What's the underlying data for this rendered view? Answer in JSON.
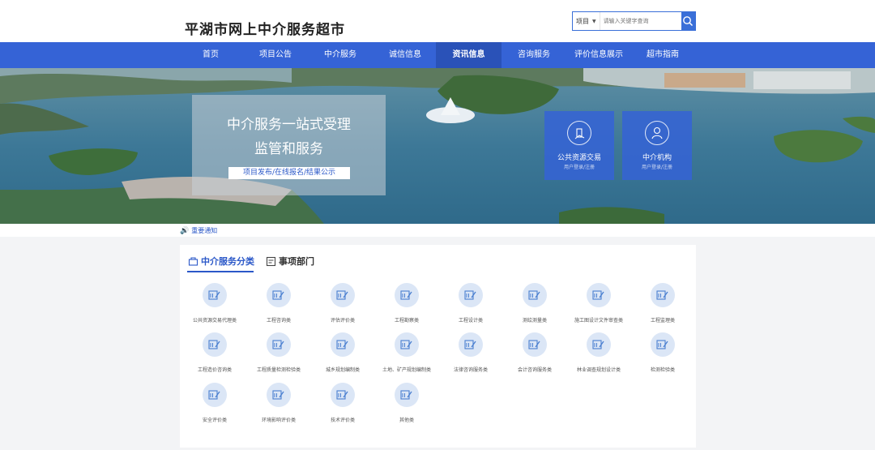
{
  "header": {
    "site_title": "平湖市网上中介服务超市",
    "search": {
      "select_value": "项目",
      "placeholder": "请输入关键字查询",
      "icon": "search-icon"
    }
  },
  "nav": {
    "items": [
      {
        "label": "首页"
      },
      {
        "label": "项目公告"
      },
      {
        "label": "中介服务"
      },
      {
        "label": "诚信信息"
      },
      {
        "label": "资讯信息",
        "active": true
      },
      {
        "label": "咨询服务"
      },
      {
        "label": "评价信息展示"
      },
      {
        "label": "超市指南"
      }
    ],
    "color": "#3563d6",
    "active_color": "#2a52b8"
  },
  "banner": {
    "slogan_line1": "中介服务一站式受理",
    "slogan_line2": "监管和服务",
    "slogan_link": "项目发布/在线报名/结果公示",
    "tiles": [
      {
        "title": "公共资源交易",
        "sub": "用户登录/注册",
        "icon": "building-hand-icon"
      },
      {
        "title": "中介机构",
        "sub": "用户登录/注册",
        "icon": "user-icon"
      }
    ]
  },
  "notice": {
    "label": "重要通知",
    "icon": "speaker-icon"
  },
  "panel": {
    "tabs": [
      {
        "label": "中介服务分类",
        "active": true,
        "icon": "basket-icon"
      },
      {
        "label": "事项部门",
        "icon": "list-icon"
      }
    ],
    "categories": [
      "公共资源交易代理类",
      "工程咨询类",
      "评估评价类",
      "工程勘察类",
      "工程设计类",
      "测绘测量类",
      "施工图设计文件审查类",
      "工程监理类",
      "工程造价咨询类",
      "工程质量检测检验类",
      "城乡规划编制类",
      "土地、矿产规划编制类",
      "法律咨询服务类",
      "会计咨询服务类",
      "林业调查规划设计类",
      "检测检验类",
      "安全评价类",
      "环境影响评价类",
      "技术评价类",
      "其他类"
    ],
    "accent": "#2b58c8"
  }
}
